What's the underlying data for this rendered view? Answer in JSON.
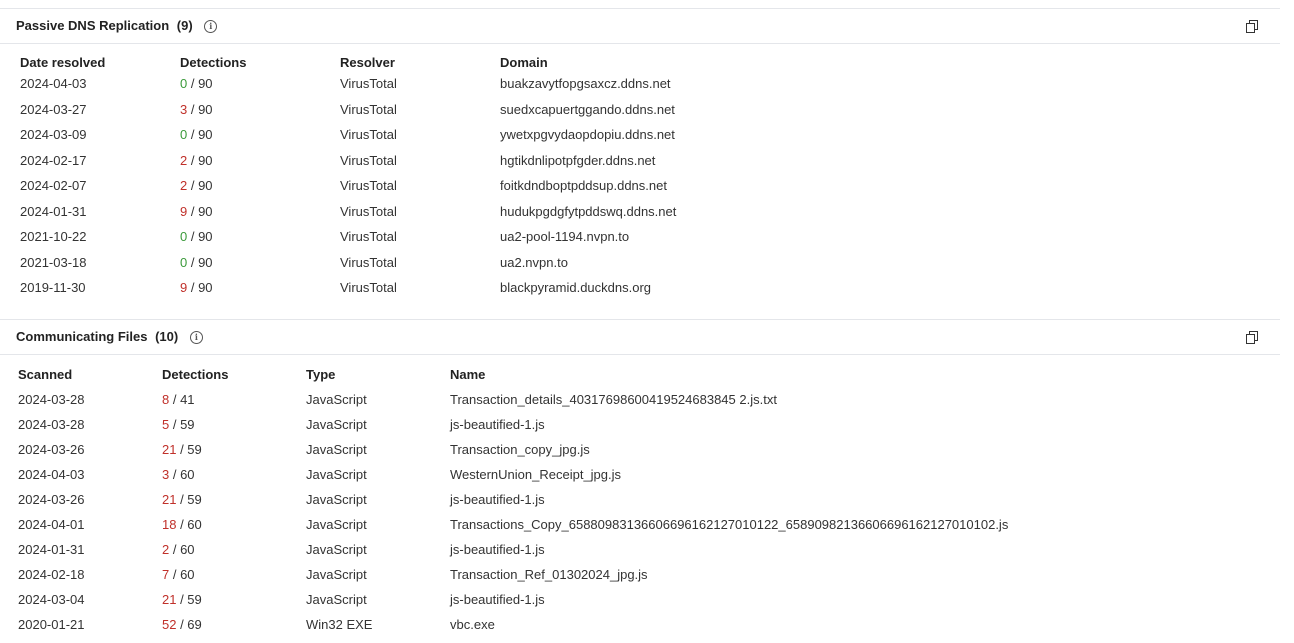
{
  "dns": {
    "title": "Passive DNS Replication",
    "count": "(9)",
    "info_icon": "info-icon",
    "copy_icon": "copy-icon",
    "headers": [
      "Date resolved",
      "Detections",
      "Resolver",
      "Domain"
    ],
    "rows": [
      {
        "date": "2024-04-03",
        "det": "0",
        "total": "/ 90",
        "resolver": "VirusTotal",
        "domain": "buakzavytfopgsaxcz.ddns.net"
      },
      {
        "date": "2024-03-27",
        "det": "3",
        "total": "/ 90",
        "resolver": "VirusTotal",
        "domain": "suedxcapuertggando.ddns.net"
      },
      {
        "date": "2024-03-09",
        "det": "0",
        "total": "/ 90",
        "resolver": "VirusTotal",
        "domain": "ywetxpgvydaopdopiu.ddns.net"
      },
      {
        "date": "2024-02-17",
        "det": "2",
        "total": "/ 90",
        "resolver": "VirusTotal",
        "domain": "hgtikdnlipotpfgder.ddns.net"
      },
      {
        "date": "2024-02-07",
        "det": "2",
        "total": "/ 90",
        "resolver": "VirusTotal",
        "domain": "foitkdndboptpddsup.ddns.net"
      },
      {
        "date": "2024-01-31",
        "det": "9",
        "total": "/ 90",
        "resolver": "VirusTotal",
        "domain": "hudukpgdgfytpddswq.ddns.net"
      },
      {
        "date": "2021-10-22",
        "det": "0",
        "total": "/ 90",
        "resolver": "VirusTotal",
        "domain": "ua2-pool-1194.nvpn.to"
      },
      {
        "date": "2021-03-18",
        "det": "0",
        "total": "/ 90",
        "resolver": "VirusTotal",
        "domain": "ua2.nvpn.to"
      },
      {
        "date": "2019-11-30",
        "det": "9",
        "total": "/ 90",
        "resolver": "VirusTotal",
        "domain": "blackpyramid.duckdns.org"
      }
    ]
  },
  "files": {
    "title": "Communicating Files",
    "count": "(10)",
    "info_icon": "info-icon",
    "copy_icon": "copy-icon",
    "headers": [
      "Scanned",
      "Detections",
      "Type",
      "Name"
    ],
    "rows": [
      {
        "date": "2024-03-28",
        "det": "8",
        "total": "/ 41",
        "type": "JavaScript",
        "name": "Transaction_details_40317698600419524683845 2.js.txt"
      },
      {
        "date": "2024-03-28",
        "det": "5",
        "total": "/ 59",
        "type": "JavaScript",
        "name": "js-beautified-1.js"
      },
      {
        "date": "2024-03-26",
        "det": "21",
        "total": "/ 59",
        "type": "JavaScript",
        "name": "Transaction_copy_jpg.js"
      },
      {
        "date": "2024-04-03",
        "det": "3",
        "total": "/ 60",
        "type": "JavaScript",
        "name": "WesternUnion_Receipt_jpg.js"
      },
      {
        "date": "2024-03-26",
        "det": "21",
        "total": "/ 59",
        "type": "JavaScript",
        "name": "js-beautified-1.js"
      },
      {
        "date": "2024-04-01",
        "det": "18",
        "total": "/ 60",
        "type": "JavaScript",
        "name": "Transactions_Copy_65880983136606696162127010122_65890982136606696162127010102.js"
      },
      {
        "date": "2024-01-31",
        "det": "2",
        "total": "/ 60",
        "type": "JavaScript",
        "name": "js-beautified-1.js"
      },
      {
        "date": "2024-02-18",
        "det": "7",
        "total": "/ 60",
        "type": "JavaScript",
        "name": "Transaction_Ref_01302024_jpg.js"
      },
      {
        "date": "2024-03-04",
        "det": "21",
        "total": "/ 59",
        "type": "JavaScript",
        "name": "js-beautified-1.js"
      },
      {
        "date": "2020-01-21",
        "det": "52",
        "total": "/ 69",
        "type": "Win32 EXE",
        "name": "vbc.exe"
      }
    ]
  },
  "colors": {
    "good": "#3a9a3a",
    "bad": "#c0302a",
    "border": "#e4e6ea"
  }
}
